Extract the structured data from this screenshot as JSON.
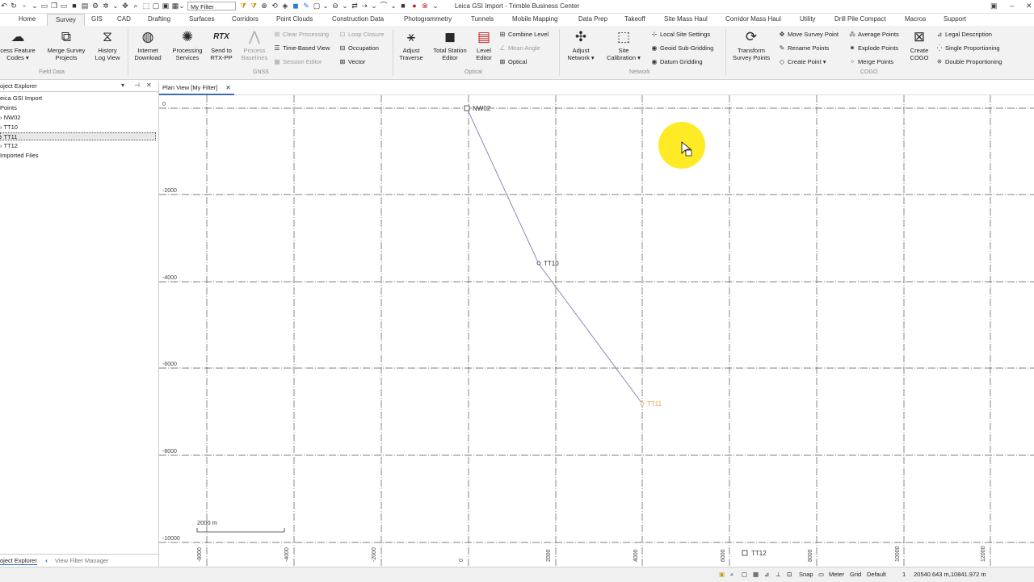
{
  "window": {
    "title": "Leica GSI Import - Trimble Business Center",
    "filter_value": "My Filter"
  },
  "tabs": [
    "Home",
    "Survey",
    "GIS",
    "CAD",
    "Drafting",
    "Surfaces",
    "Corridors",
    "Point Clouds",
    "Construction Data",
    "Photogrammetry",
    "Tunnels",
    "Mobile Mapping",
    "Data Prep",
    "Takeoff",
    "Site Mass Haul",
    "Corridor Mass Haul",
    "Utility",
    "Drill Pile Compact",
    "Macros",
    "Support"
  ],
  "active_tab": "Survey",
  "ribbon": {
    "field_data": {
      "group": "Field Data",
      "process_feature_codes": [
        "cess Feature",
        "Codes ▾"
      ],
      "merge_survey_projects": [
        "Merge Survey",
        "Projects"
      ],
      "history_log_view": [
        "History",
        "Log View"
      ]
    },
    "gnss": {
      "group": "GNSS",
      "internet_download": [
        "Internet",
        "Download"
      ],
      "processing_services": [
        "Processing",
        "Services"
      ],
      "send_to_rtx_pp": [
        "Send to",
        "RTX-PP"
      ],
      "process_baselines": [
        "Process",
        "Baselines"
      ],
      "clear_processing": "Clear Processing",
      "time_based_view": "Time-Based View",
      "session_editor": "Session Editor",
      "loop_closure": "Loop Closure",
      "occupation": "Occupation",
      "vector": "Vector"
    },
    "optical": {
      "group": "Optical",
      "adjust_traverse": [
        "Adjust",
        "Traverse"
      ],
      "total_station_editor": [
        "Total Station",
        "Editor"
      ],
      "level_editor": [
        "Level",
        "Editor"
      ],
      "combine_level": "Combine Level",
      "mean_angle": "Mean Angle",
      "optical": "Optical"
    },
    "network": {
      "group": "Network",
      "adjust_network": [
        "Adjust",
        "Network ▾"
      ],
      "site_calibration": [
        "Site",
        "Calibration ▾"
      ],
      "local_site_settings": "Local Site Settings",
      "geoid_sub_gridding": "Geoid Sub-Gridding",
      "datum_gridding": "Datum Gridding"
    },
    "cogo": {
      "group": "COGO",
      "transform_survey_points": [
        "Transform",
        "Survey Points"
      ],
      "move_survey_point": "Move Survey Point",
      "rename_points": "Rename Points",
      "create_point": "Create Point ▾",
      "average_points": "Average Points",
      "explode_points": "Explode Points",
      "merge_points": "Merge Points",
      "create_cogo": [
        "Create",
        "COGO"
      ],
      "legal_description": "Legal Description",
      "single_proportioning": "Single Proportioning",
      "double_proportioning": "Double Proportioning"
    }
  },
  "project_explorer": {
    "title": "oject Explorer",
    "items": [
      "eica GSI Import",
      "Points",
      "NW02",
      "TT10",
      "TT11",
      "TT12",
      "Imported Files"
    ],
    "selected": "TT11",
    "bottom_tabs": [
      "oject Explorer",
      "View Filter Manager"
    ]
  },
  "plan_view": {
    "tab_label": "Plan View [My Filter]",
    "y_labels": [
      "0",
      "-2000",
      "-4000",
      "-6000",
      "-8000",
      "-10000"
    ],
    "x_labels": [
      "-6000",
      "-4000",
      "-2000",
      "0",
      "2000",
      "4000",
      "6000",
      "8000",
      "10000",
      "12000"
    ],
    "points": [
      {
        "name": "NW02",
        "color": "#333333"
      },
      {
        "name": "TT10",
        "color": "#333333"
      },
      {
        "name": "TT11",
        "color": "#e8a34a"
      },
      {
        "name": "TT12",
        "color": "#333333"
      }
    ],
    "scale_label": "2000 m",
    "highlight_color": "#ffe600"
  },
  "status": {
    "snap": "Snap",
    "units": "Meter",
    "grid": "Grid",
    "default": "Default",
    "counter": "1",
    "coords": "20540.643 m,10841.972 m"
  }
}
